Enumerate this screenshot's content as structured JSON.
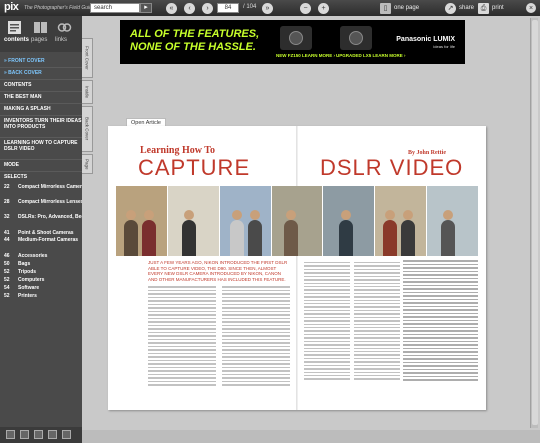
{
  "topbar": {
    "logo": "pix",
    "subtitle": "The Photographer's Field Guide",
    "search_value": "search",
    "search_go": "▸",
    "page_value": "84",
    "page_total": "/ 104",
    "one_page_label": "one page",
    "share_label": "share",
    "print_label": "print"
  },
  "sidebar": {
    "tabs": [
      {
        "label": "contents"
      },
      {
        "label": "pages"
      },
      {
        "label": "links"
      }
    ],
    "vtabs": [
      "Front Cover",
      "Inside",
      "Back Cover",
      "Page"
    ],
    "items": [
      {
        "label": "» FRONT COVER",
        "kind": "link"
      },
      {
        "label": "» BACK COVER",
        "kind": "link"
      },
      {
        "label": "CONTENTS",
        "kind": "head"
      },
      {
        "label": "THE BEST MAN",
        "kind": "head"
      },
      {
        "label": "MAKING A SPLASH",
        "kind": "head"
      },
      {
        "label": "INVENTORS TURN THEIR IDEAS INTO PRODUCTS",
        "kind": "tall"
      },
      {
        "label": "LEARNING HOW TO CAPTURE DSLR VIDEO",
        "kind": "tall"
      },
      {
        "label": "MODE",
        "kind": "head"
      },
      {
        "label": "SELECTS",
        "kind": "head"
      }
    ],
    "selects": [
      {
        "num": "22",
        "label": "Compact Mirrorless Cameras",
        "tall": true
      },
      {
        "num": "28",
        "label": "Compact Mirrorless Lenses",
        "tall": true
      },
      {
        "num": "32",
        "label": "DSLRs: Pro, Advanced, Beginner",
        "tall": true
      },
      {
        "num": "41",
        "label": "Point & Shoot Cameras",
        "tall": false
      },
      {
        "num": "44",
        "label": "Medium-Format Cameras",
        "tall": true
      },
      {
        "num": "46",
        "label": "Accessories",
        "tall": false
      },
      {
        "num": "50",
        "label": "Bags",
        "tall": false
      },
      {
        "num": "52",
        "label": "Tripods",
        "tall": false
      },
      {
        "num": "52",
        "label": "Computers",
        "tall": false
      },
      {
        "num": "54",
        "label": "Software",
        "tall": false
      },
      {
        "num": "52",
        "label": "Printers",
        "tall": false
      }
    ]
  },
  "ad": {
    "headline_1": "ALL OF THE FEATURES,",
    "headline_2": "NONE OF THE HASSLE.",
    "cam1_label": "NEW FZ150 LEARN MORE ›",
    "cam2_label": "UPGRADED LX5 LEARN MORE ›",
    "brand": "Panasonic  LUMIX",
    "brand_tag": "ideas for life"
  },
  "article": {
    "tab_label": "Open Article",
    "kicker": "Learning How To",
    "title_left": "CAPTURE",
    "title_right": "DSLR VIDEO",
    "byline": "By John Rettie",
    "lead": "Just a few years ago, Nikon introduced the first DSLR able to capture video, the D90. Since then, almost every new DSLR camera introduced by Nikon, Canon and other manufacturers has included this feature."
  },
  "colors": {
    "accent_red": "#c0392b",
    "link_blue": "#7ec8ff",
    "ad_green": "#c7ff2b"
  }
}
